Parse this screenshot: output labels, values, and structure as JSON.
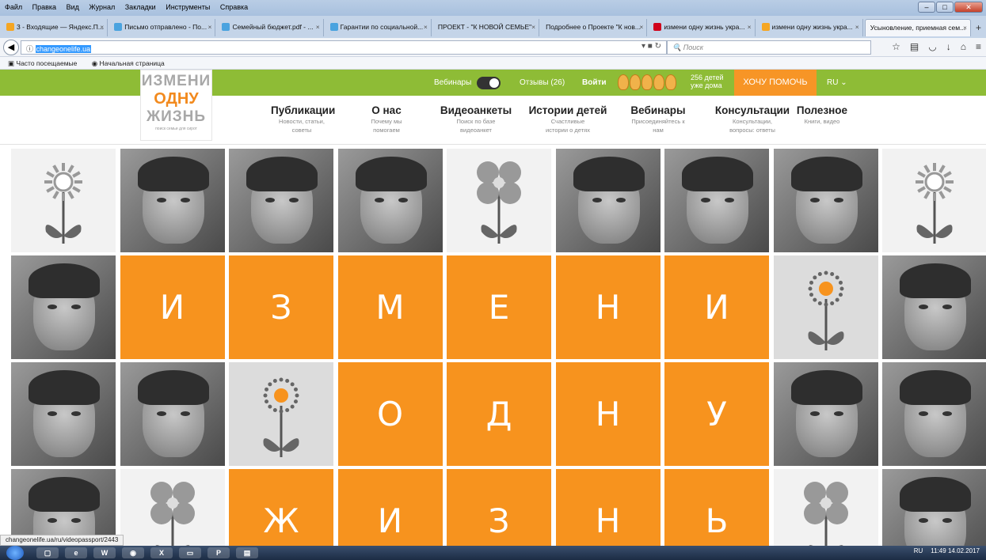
{
  "menu": [
    "Файл",
    "Правка",
    "Вид",
    "Журнал",
    "Закладки",
    "Инструменты",
    "Справка"
  ],
  "tabs": [
    {
      "label": "3 - Входящие — Яндекс.П...",
      "color": "#f5a623"
    },
    {
      "label": "Письмо отправлено - По...",
      "color": "#4aa3df"
    },
    {
      "label": "Семейный бюджет.pdf - ...",
      "color": "#4aa3df"
    },
    {
      "label": "Гарантии по социальной...",
      "color": "#4aa3df"
    },
    {
      "label": "ПРОЕКТ - \"К НОВОЙ СЕМЬЕ\"",
      "color": "#cccccc"
    },
    {
      "label": "Подробнее о Проекте \"К нов...",
      "color": "#cccccc"
    },
    {
      "label": "измени одну жизнь укра...",
      "color": "#d0021b"
    },
    {
      "label": "измени одну жизнь укра...",
      "color": "#f5a623"
    },
    {
      "label": "Усыновление, приемная сем...",
      "color": "#cccccc"
    }
  ],
  "address": {
    "url": "changeonelife.ua",
    "search_placeholder": "Поиск"
  },
  "bookmarks": [
    "Часто посещаемые",
    "Начальная страница"
  ],
  "site": {
    "webinars_label": "Вебинары",
    "reviews_label": "Отзывы (26)",
    "login_label": "Войти",
    "counter_line1": "256 детей",
    "counter_line2": "уже дома",
    "help_button": "ХОЧУ ПОМОЧЬ",
    "lang": "RU"
  },
  "logo": {
    "line1": "ИЗМЕНИ",
    "line2": "ОДНУ",
    "line3": "ЖИЗНЬ",
    "tagline": "поиск семьи для сирот"
  },
  "nav": [
    {
      "title": "Публикации",
      "sub1": "Новости, статьи,",
      "sub2": "советы"
    },
    {
      "title": "О нас",
      "sub1": "Почему мы",
      "sub2": "помогаем"
    },
    {
      "title": "Видеоанкеты",
      "sub1": "Поиск по базе",
      "sub2": "видеоанкет"
    },
    {
      "title": "Истории детей",
      "sub1": "Счастливые",
      "sub2": "истории о детях"
    },
    {
      "title": "Вебинары",
      "sub1": "Присоединяйтесь к",
      "sub2": "нам"
    },
    {
      "title": "Консультации",
      "sub1": "Консультации,",
      "sub2": "вопросы: ответы"
    },
    {
      "title": "Полезное",
      "sub1": "Книги, видео",
      "sub2": ""
    }
  ],
  "tiles": [
    [
      "sunflower",
      "photo",
      "photo",
      "photo",
      "flower",
      "photo",
      "photo",
      "photo",
      "sunflower"
    ],
    [
      "photo",
      "И",
      "З",
      "М",
      "Е",
      "Н",
      "И",
      "dotflower",
      "photo"
    ],
    [
      "photo",
      "photo",
      "dotflower",
      "О",
      "Д",
      "Н",
      "У",
      "photo",
      "photo"
    ],
    [
      "photo",
      "flower",
      "Ж",
      "И",
      "З",
      "Н",
      "Ь",
      "flower",
      "photo"
    ]
  ],
  "status_url": "changeonelife.ua/ru/videopassport/2443",
  "tray": {
    "lang": "RU",
    "time": "11:49",
    "date": "14.02.2017"
  },
  "colors": {
    "green": "#8ebc36",
    "orange": "#f7931e",
    "logo_orange": "#f28a1e"
  }
}
